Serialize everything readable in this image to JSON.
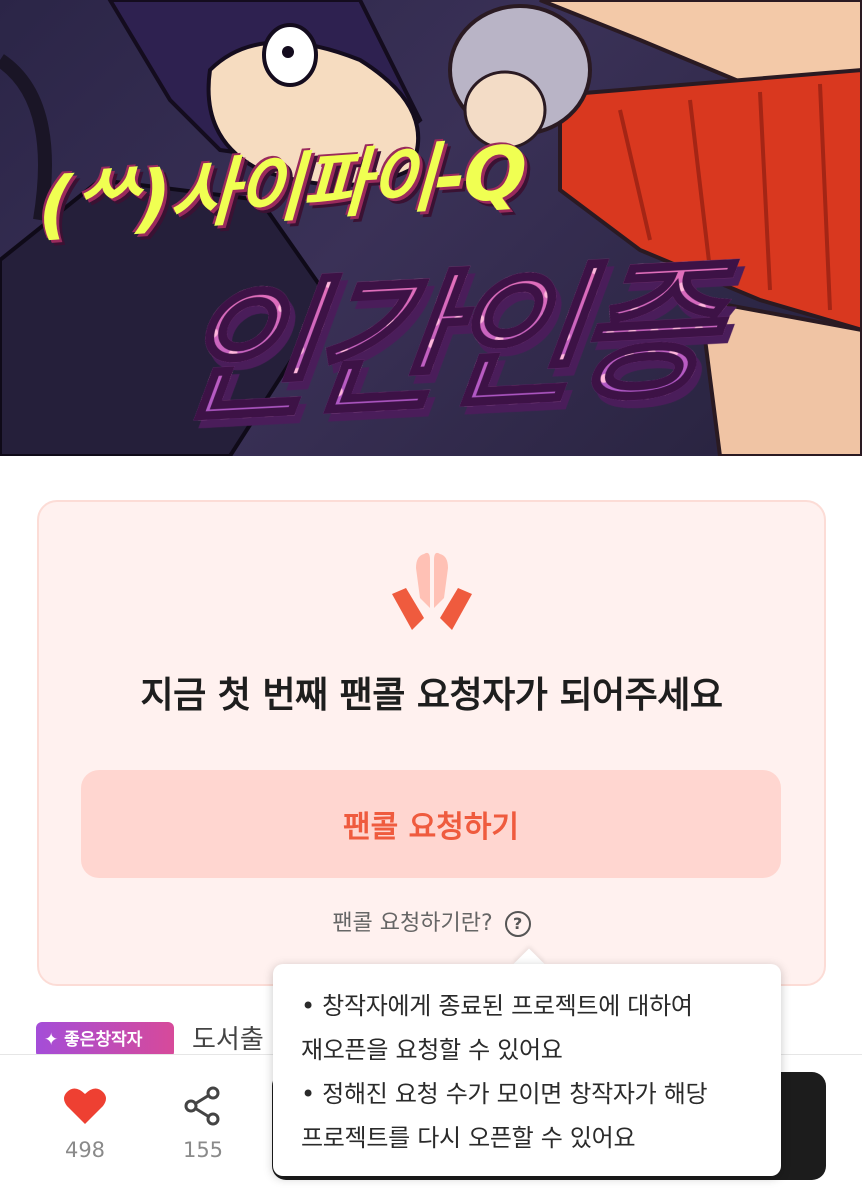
{
  "hero": {
    "title_small": "(ᄊ)사이파이-Q",
    "title_big": "인간인증"
  },
  "fancall": {
    "icon": "praying-hands-icon",
    "headline": "지금 첫 번째 팬콜 요청자가 되어주세요",
    "button_label": "팬콜 요청하기",
    "help_text": "팬콜 요청하기란?",
    "help_icon_glyph": "?",
    "accent_color": "#ef5b3e",
    "card_bg": "#fff1ef"
  },
  "tooltip": {
    "lines": [
      "• 창작자에게 종료된 프로젝트에 대하여",
      "재오픈을 요청할 수 있어요",
      "• 정해진 요청 수가 모이면 창작자가 해당",
      "프로젝트를 다시 오픈할 수 있어요"
    ]
  },
  "info": {
    "badge_label": "✦ 좋은창작자",
    "publisher_text": "도서출"
  },
  "bottom_bar": {
    "like_count": "498",
    "share_count": "155",
    "like_icon": "heart-icon",
    "share_icon": "share-icon"
  }
}
